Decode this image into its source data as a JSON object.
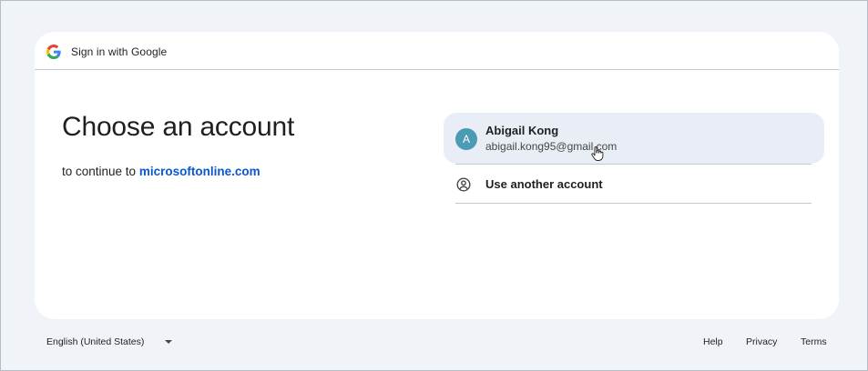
{
  "header": {
    "title": "Sign in with Google",
    "logo_icon": "google-g-icon"
  },
  "main": {
    "heading": "Choose an account",
    "subtitle_prefix": "to continue to",
    "subtitle_link": "microsoftonline.com"
  },
  "accounts": [
    {
      "avatar_initial": "A",
      "avatar_color": "#4a9bb3",
      "name": "Abigail Kong",
      "email": "abigail.kong95@gmail.com"
    }
  ],
  "other_account": {
    "label": "Use another account",
    "icon": "person-circle-icon"
  },
  "footer": {
    "language": "English (United States)",
    "links": {
      "help": "Help",
      "privacy": "Privacy",
      "terms": "Terms"
    }
  },
  "colors": {
    "page_background": "#f0f4f9",
    "card_background": "#ffffff",
    "link_blue": "#0b57d0",
    "hover_row": "#e9eef6"
  }
}
